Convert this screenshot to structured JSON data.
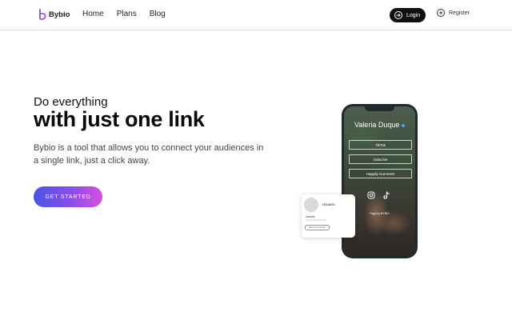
{
  "header": {
    "brand": "Bybio",
    "nav": [
      "Home",
      "Plans",
      "Blog"
    ],
    "login_label": "Login",
    "register_label": "Register"
  },
  "hero": {
    "subtitle": "Do everything",
    "title": "with just one link",
    "description": "Bybio is a tool that allows you to connect your audiences in a single link, just a click away.",
    "cta_label": "GET STARTED"
  },
  "phone": {
    "profile_name": "Valeria Duque",
    "links": [
      "TikTok",
      "Valactive",
      "Happily Gummies"
    ],
    "footer": "Page by BYBIO"
  },
  "card": {
    "user_label": "Usuario",
    "name_label": "Usuario",
    "chip_label": "Bybio.com/usuario"
  },
  "colors": {
    "accent_start": "#4a55e8",
    "accent_end": "#d84fe0",
    "login_bg": "#111111"
  }
}
